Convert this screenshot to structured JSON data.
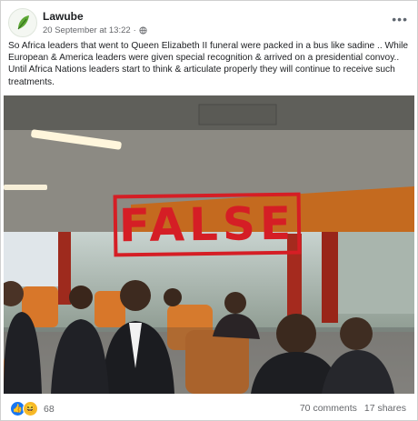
{
  "post": {
    "author": "Lawube",
    "date": "20 September at 13:22",
    "separator": "·",
    "privacy_icon": "globe-icon",
    "more_label": "•••",
    "text": "So Africa leaders that went to Queen Elizabeth II funeral were packed in a bus like sadine .. While European & America leaders were given special recognition & arrived on a presidential convoy.. Until Africa Nations leaders start to think & articulate properly they will continue to receive such treatments."
  },
  "photo": {
    "stamp_label": "FALSE",
    "stamp_color": "#d51e25"
  },
  "footer": {
    "reaction_icons": [
      "like-icon",
      "haha-icon"
    ],
    "reaction_count": "68",
    "comments": "70 comments",
    "shares": "17 shares"
  },
  "colors": {
    "text_primary": "#1c1e21",
    "text_secondary": "#65676b",
    "like_blue": "#1877f2",
    "haha_yellow": "#f7b928",
    "seat_orange": "#d8772a",
    "curtain_red": "#a52a1e"
  }
}
